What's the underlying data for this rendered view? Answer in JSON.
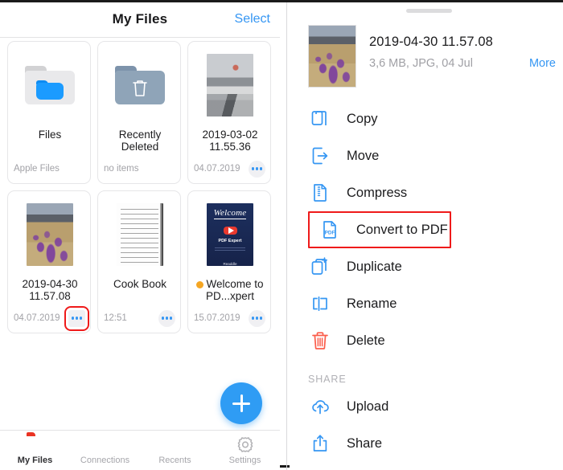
{
  "left_panel": {
    "nav": {
      "title": "My Files",
      "select_label": "Select"
    },
    "grid_items": [
      {
        "name": "Files",
        "subtitle": "Apple Files",
        "thumb": "folder-grey-blue",
        "has_dots": false,
        "dots_highlighted": false,
        "badge": ""
      },
      {
        "name": "Recently Deleted",
        "subtitle": "no items",
        "thumb": "folder-slate-trash",
        "has_dots": false,
        "dots_highlighted": false,
        "badge": ""
      },
      {
        "name": "2019-03-02 11.55.36",
        "subtitle": "04.07.2019",
        "thumb": "photo-balloon",
        "has_dots": true,
        "dots_highlighted": false,
        "badge": ""
      },
      {
        "name": "2019-04-30 11.57.08",
        "subtitle": "04.07.2019",
        "thumb": "photo-crocus",
        "has_dots": true,
        "dots_highlighted": true,
        "badge": ""
      },
      {
        "name": "Cook Book",
        "subtitle": "12:51",
        "thumb": "photo-handwritten-note",
        "has_dots": true,
        "dots_highlighted": false,
        "badge": ""
      },
      {
        "name": "Welcome to PD...xpert",
        "subtitle": "15.07.2019",
        "thumb": "pdf-expert-cover",
        "has_dots": true,
        "dots_highlighted": false,
        "badge": "unread-dot"
      }
    ],
    "fab": {
      "icon": "plus-icon",
      "color": "#2f9cf4"
    },
    "tabbar": [
      {
        "label": "My Files",
        "icon": "pdf-expert-folder-icon",
        "active": true
      },
      {
        "label": "Connections",
        "icon": "wifi-icon",
        "active": false
      },
      {
        "label": "Recents",
        "icon": "clock-icon",
        "active": false
      },
      {
        "label": "Settings",
        "icon": "gear-icon",
        "active": false
      }
    ]
  },
  "right_panel": {
    "grabber": "drag-handle",
    "file": {
      "title": "2019-04-30 11.57.08",
      "meta": "3,6 MB, JPG, 04 Jul",
      "more_label": "More",
      "thumb": "photo-crocus"
    },
    "actions": [
      {
        "label": "Copy",
        "icon": "copy-icon",
        "color": "#3596f3",
        "highlighted": false
      },
      {
        "label": "Move",
        "icon": "move-icon",
        "color": "#3596f3",
        "highlighted": false
      },
      {
        "label": "Compress",
        "icon": "compress-icon",
        "color": "#3596f3",
        "highlighted": false
      },
      {
        "label": "Convert to PDF",
        "icon": "pdf-file-icon",
        "color": "#3596f3",
        "highlighted": true
      },
      {
        "label": "Duplicate",
        "icon": "duplicate-icon",
        "color": "#3596f3",
        "highlighted": false
      },
      {
        "label": "Rename",
        "icon": "rename-icon",
        "color": "#3596f3",
        "highlighted": false
      },
      {
        "label": "Delete",
        "icon": "trash-icon",
        "color": "#fb5c4a",
        "highlighted": false
      }
    ],
    "share_section": {
      "label": "SHARE",
      "actions": [
        {
          "label": "Upload",
          "icon": "cloud-upload-icon",
          "color": "#3596f3",
          "highlighted": false
        },
        {
          "label": "Share",
          "icon": "share-icon",
          "color": "#3596f3",
          "highlighted": false
        }
      ]
    }
  },
  "colors": {
    "accent_blue": "#3596f3",
    "highlight_red": "#ef1a1a",
    "brand_red": "#ea3323",
    "badge_orange": "#f5a623"
  }
}
